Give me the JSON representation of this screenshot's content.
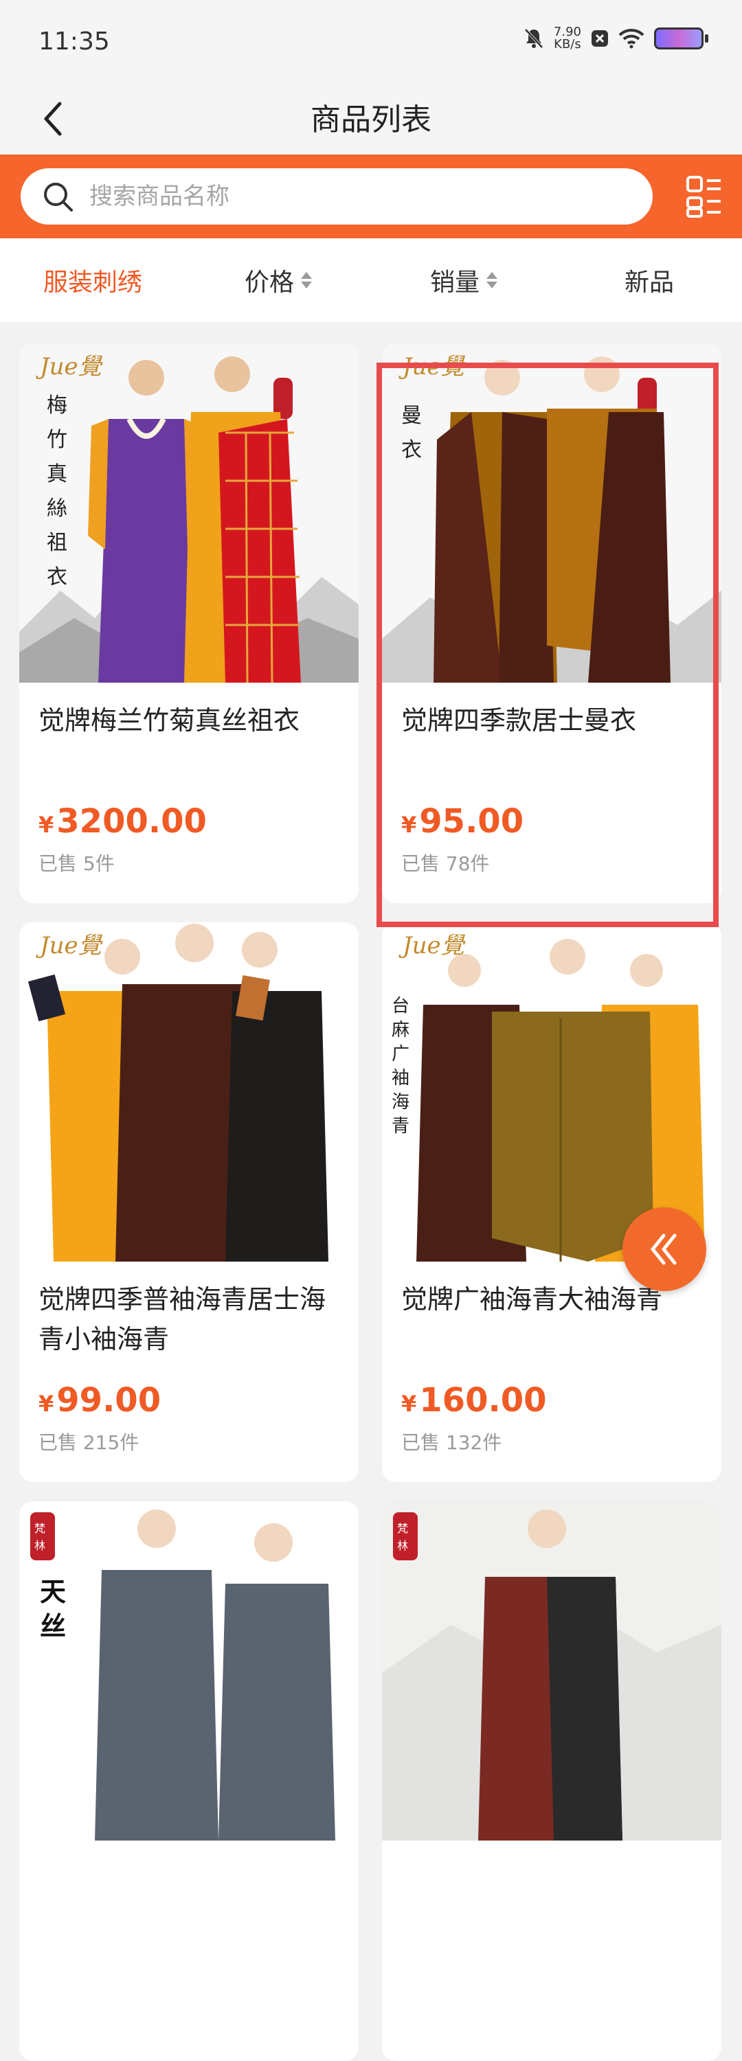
{
  "status_bar": {
    "time": "11:35",
    "net_speed_value": "7.90",
    "net_speed_unit": "KB/s"
  },
  "header": {
    "title": "商品列表",
    "back_icon": "chevron-left-icon"
  },
  "search": {
    "placeholder": "搜索商品名称",
    "value": "",
    "accent_color": "#f5652c"
  },
  "filters": [
    {
      "label": "服装刺绣",
      "active": true
    },
    {
      "label": "价格",
      "sortable": true
    },
    {
      "label": "销量",
      "sortable": true
    },
    {
      "label": "新品"
    }
  ],
  "products": [
    {
      "name": "觉牌梅兰竹菊真丝祖衣",
      "currency": "¥",
      "price": "3200.00",
      "sold": "已售 5件",
      "image_text": "梅竹真絲祖衣",
      "brand": "Jue覺"
    },
    {
      "name": "觉牌四季款居士曼衣",
      "currency": "¥",
      "price": "95.00",
      "sold": "已售 78件",
      "image_text": "曼衣",
      "brand": "Jue覺"
    },
    {
      "name": "觉牌四季普袖海青居士海青小袖海青",
      "currency": "¥",
      "price": "99.00",
      "sold": "已售 215件",
      "image_text": "",
      "brand": "Jue覺"
    },
    {
      "name": "觉牌广袖海青大袖海青",
      "currency": "¥",
      "price": "160.00",
      "sold": "已售 132件",
      "image_text": "台麻广袖海青",
      "brand": "Jue覺"
    },
    {
      "name": "",
      "currency": "",
      "price": "",
      "sold": "",
      "image_text": "天丝",
      "brand": "梵林"
    },
    {
      "name": "",
      "currency": "",
      "price": "",
      "sold": "",
      "image_text": "",
      "brand": "梵林"
    }
  ],
  "fab_icon": "double-chevron-left-icon"
}
